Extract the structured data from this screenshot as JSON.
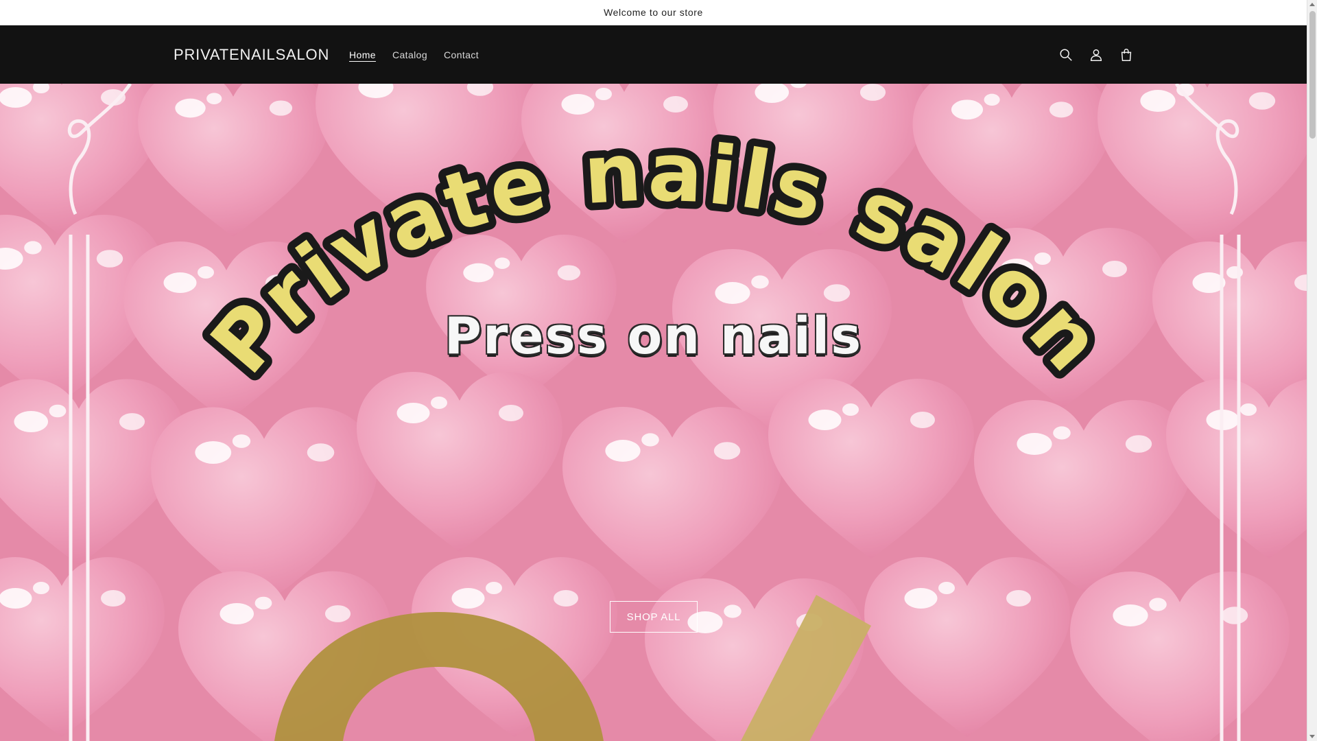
{
  "announcement": {
    "text": "Welcome to our store"
  },
  "header": {
    "brand": "PRIVATENAILSALON",
    "nav": [
      {
        "label": "Home",
        "active": true
      },
      {
        "label": "Catalog",
        "active": false
      },
      {
        "label": "Contact",
        "active": false
      }
    ],
    "icons": [
      "search-icon",
      "account-icon",
      "cart-icon"
    ]
  },
  "hero": {
    "title": "Private nails salon",
    "subtitle": "Press on nails",
    "cta_label": "SHOP ALL",
    "colors": {
      "background": "#e58aa8",
      "heart": "#f4b3c8",
      "title_fill": "#e9dc74",
      "gold": "#b89a4a"
    }
  }
}
